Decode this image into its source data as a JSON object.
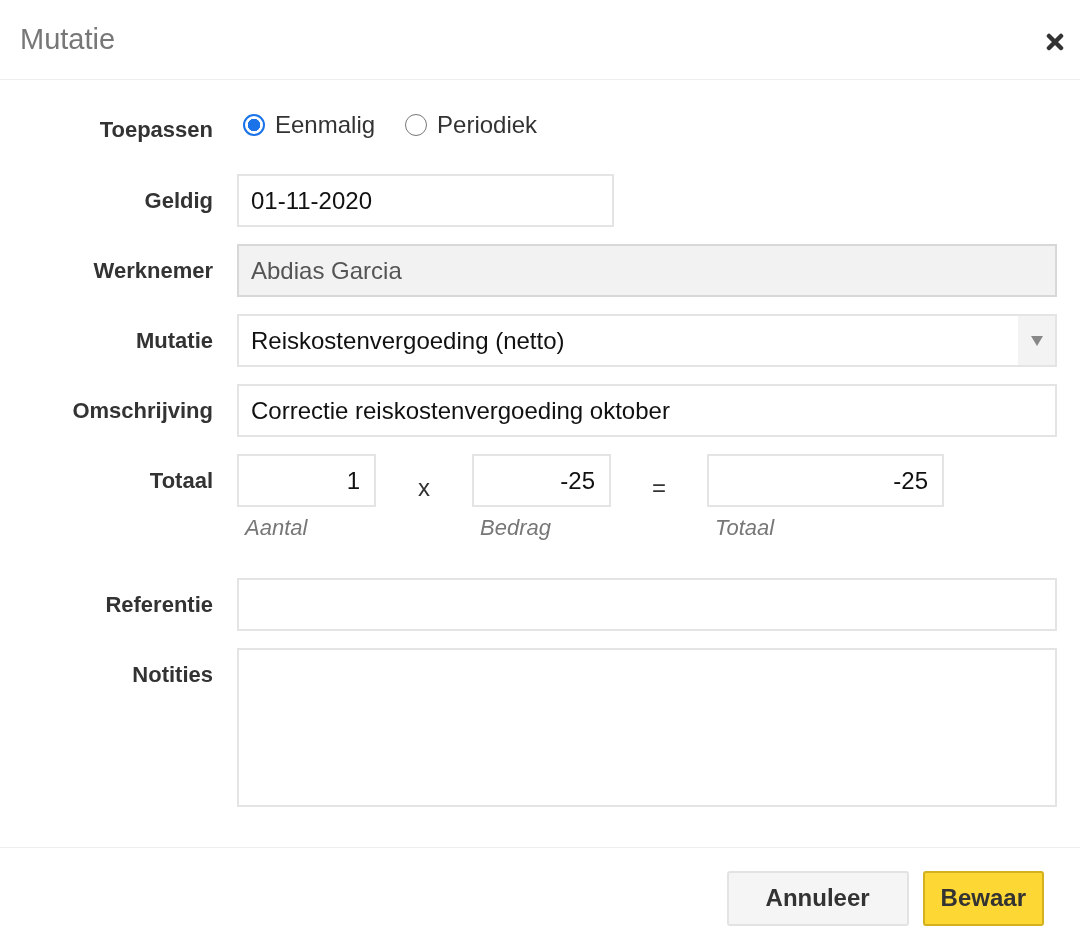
{
  "dialog": {
    "title": "Mutatie"
  },
  "fields": [
    {
      "kind": "radio",
      "label": "Toepassen",
      "options": [
        {
          "label": "Eenmalig",
          "selected": true
        },
        {
          "label": "Periodiek",
          "selected": false
        }
      ]
    },
    {
      "kind": "date",
      "label": "Geldig",
      "value": "01-11-2020",
      "disabled": false
    },
    {
      "kind": "text",
      "label": "Werknemer",
      "value": "Abdias Garcia",
      "disabled": true
    },
    {
      "kind": "select",
      "label": "Mutatie",
      "value": "Reiskostenvergoeding (netto)"
    },
    {
      "kind": "text",
      "label": "Omschrijving",
      "value": "Correctie reiskostenvergoeding oktober",
      "disabled": false
    },
    {
      "kind": "calc",
      "label": "Totaal",
      "parts": [
        {
          "kind": "input",
          "value": "1",
          "hint": "Aantal"
        },
        {
          "kind": "operator",
          "text": "x"
        },
        {
          "kind": "input",
          "value": "-25",
          "hint": "Bedrag"
        },
        {
          "kind": "operator",
          "text": "="
        },
        {
          "kind": "result",
          "value": "-25",
          "hint": "Totaal"
        }
      ]
    },
    {
      "kind": "text",
      "label": "Referentie",
      "disabled": false
    },
    {
      "kind": "textarea",
      "label": "Notities"
    }
  ],
  "buttons": [
    {
      "label": "Annuleer",
      "kind": "secondary"
    },
    {
      "label": "Bewaar",
      "kind": "primary"
    }
  ]
}
